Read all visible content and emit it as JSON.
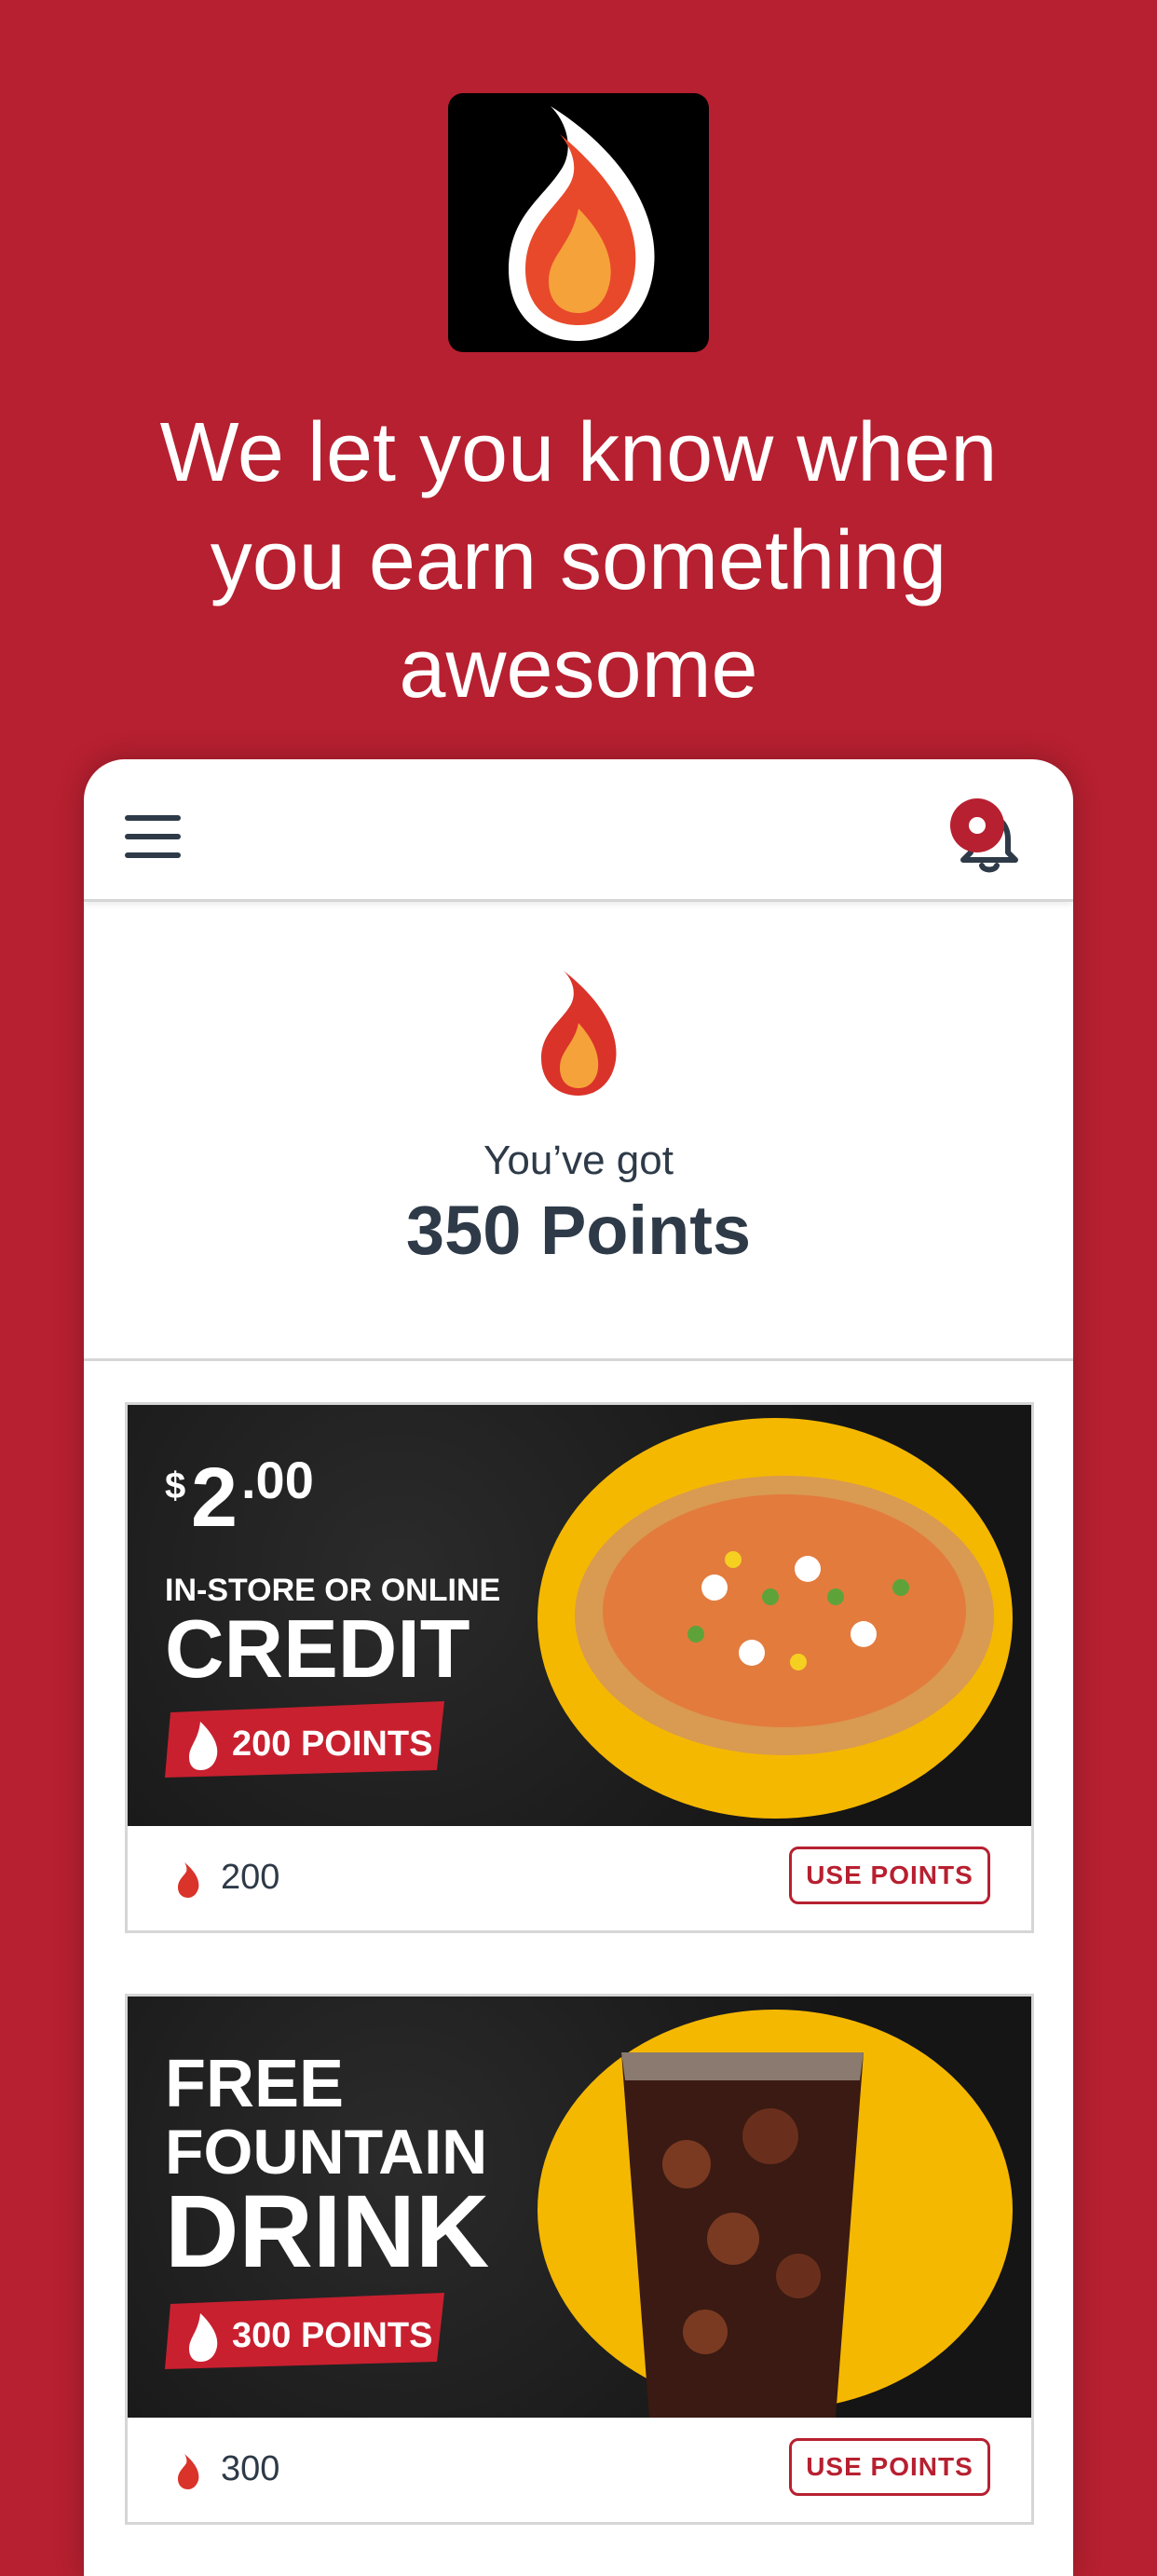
{
  "headline": "We let you know when\nyou earn something\nawesome",
  "colors": {
    "brand_red": "#b72030",
    "text_dark": "#2e3a48",
    "yellow": "#f5b800"
  },
  "header": {
    "menu_icon": "hamburger-menu-icon",
    "bell_icon": "bell-icon"
  },
  "points": {
    "subtitle": "You’ve got",
    "value": "350 Points"
  },
  "rewards": [
    {
      "banner_price_symbol": "$",
      "banner_price_whole": "2",
      "banner_price_cents": ".00",
      "banner_line1": "IN-STORE OR ONLINE",
      "banner_line2": "CREDIT",
      "banner_points": "200 POINTS",
      "points": "200",
      "button": "USE POINTS"
    },
    {
      "banner_line1": "FREE",
      "banner_line2": "FOUNTAIN",
      "banner_line3": "DRINK",
      "banner_points": "300 POINTS",
      "points": "300",
      "button": "USE POINTS"
    }
  ]
}
